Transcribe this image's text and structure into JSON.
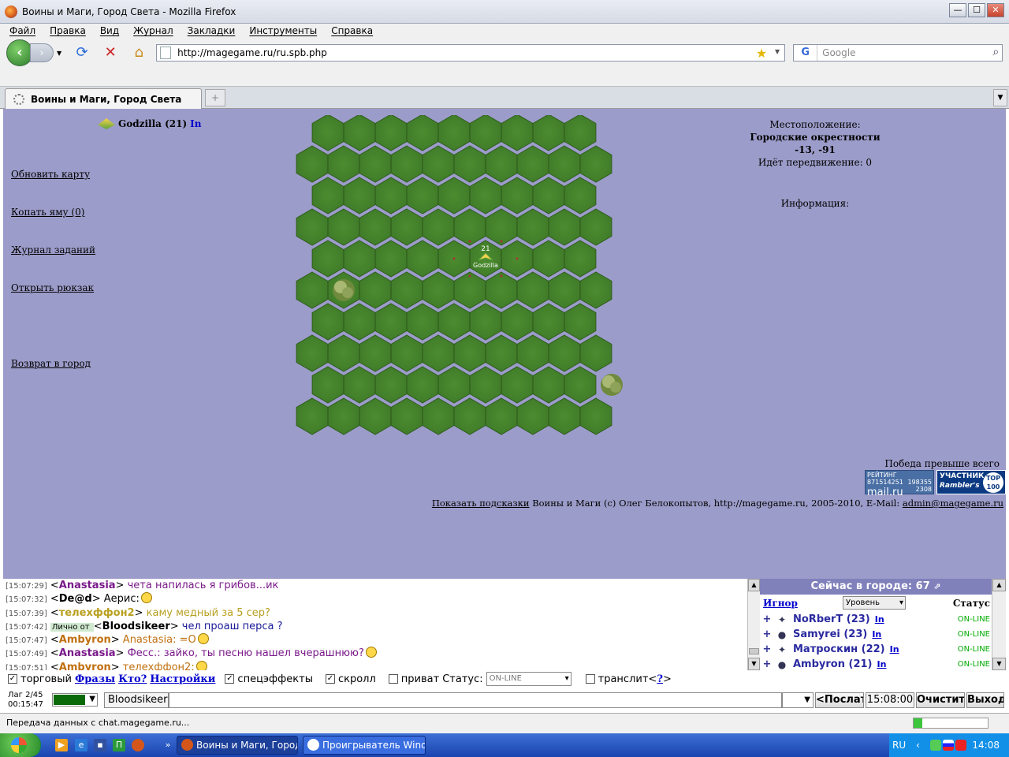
{
  "window": {
    "title": "Воины и Маги, Город Света - Mozilla Firefox",
    "min": "—",
    "max": "☐",
    "close": "✕"
  },
  "menu": [
    "Файл",
    "Правка",
    "Вид",
    "Журнал",
    "Закладки",
    "Инструменты",
    "Справка"
  ],
  "nav": {
    "url": "http://magegame.ru/ru.spb.php",
    "search_placeholder": "Google"
  },
  "tab": {
    "title": "Воины и Маги, Город Света"
  },
  "game": {
    "player": {
      "name": "Godzilla (21)",
      "in": "In"
    },
    "links": [
      "Обновить карту",
      "Копать яму (0)",
      "Журнал заданий",
      "Открыть рюкзак",
      "Возврат в город"
    ],
    "location": {
      "label": "Местоположение:",
      "place": "Городские окрестности",
      "coords": "-13, -91",
      "movement": "Идёт передвижение: 0"
    },
    "info_label": "Информация:",
    "map": {
      "cols": 10,
      "rows": 10,
      "player_marker": {
        "level": "21",
        "name": "Godzilla",
        "col": 5,
        "row": 4
      },
      "bushes": [
        {
          "col": 1,
          "row": 5
        },
        {
          "col": 9,
          "row": 8
        }
      ],
      "grass_color": "#3f7a28",
      "edge_color": "#2e5c1c"
    },
    "victory": "Победа превыше всего",
    "counters": {
      "mailru": {
        "line1": "РЕЙТИНГ 871514251",
        "brand": "mail.ru",
        "n1": "198355",
        "n2": "2308"
      },
      "rambler": {
        "line1": "УЧАСТНИК",
        "line2": "Rambler's",
        "top_a": "TOP",
        "top_b": "100"
      }
    },
    "footer": {
      "hints": "Показать подсказки",
      "copyright": "Воины и Маги (c) Олег Белокопытов, http://magegame.ru, 2005-2010, E-Mail:",
      "email": "admin@magegame.ru"
    }
  },
  "chat": {
    "messages": [
      {
        "time": "[15:07:29]",
        "nick": "Anastasia",
        "nick_color": "#7a1a8a",
        "text": "чета напилась я грибов...ик",
        "text_color": "#7a1a8a",
        "smile": false,
        "private": ""
      },
      {
        "time": "[15:07:32]",
        "nick": "De@d",
        "nick_color": "#000000",
        "text": "Аерис:",
        "text_color": "#000000",
        "smile": true,
        "private": ""
      },
      {
        "time": "[15:07:39]",
        "nick": "телехффон2",
        "nick_color": "#b8a020",
        "text": "каму медный за 5 сер?",
        "text_color": "#b8a020",
        "smile": false,
        "private": ""
      },
      {
        "time": "[15:07:42]",
        "nick": "Bloodsikeer",
        "nick_color": "#000000",
        "text": "чел проаш перса ?",
        "text_color": "#1a1a9a",
        "smile": false,
        "private": "Лично от "
      },
      {
        "time": "[15:07:47]",
        "nick": "Ambyron",
        "nick_color": "#c07010",
        "text": "Anastasia: =O",
        "text_color": "#c07010",
        "smile": true,
        "private": ""
      },
      {
        "time": "[15:07:49]",
        "nick": "Anastasia",
        "nick_color": "#7a1a8a",
        "text": "Фесс.: зайко, ты песню нашел вчерашнюю?",
        "text_color": "#7a1a8a",
        "smile": true,
        "private": ""
      },
      {
        "time": "[15:07:51]",
        "nick": "Ambyron",
        "nick_color": "#c07010",
        "text": "телехффон2:",
        "text_color": "#c07010",
        "smile": true,
        "private": ""
      }
    ]
  },
  "online": {
    "title": "Сейчас в городе: 67",
    "ignore": "Игнор",
    "sort": "Уровень",
    "status_header": "Статус",
    "users": [
      {
        "name": "NoRberT (23)",
        "in": "In",
        "status": "ON-LINE",
        "cls": "✦"
      },
      {
        "name": "Samyrei (23)",
        "in": "In",
        "status": "ON-LINE",
        "cls": "●"
      },
      {
        "name": "Матроскин (22)",
        "in": "In",
        "status": "ON-LINE",
        "cls": "✦"
      },
      {
        "name": "Ambyron (21)",
        "in": "In",
        "status": "ON-LINE",
        "cls": "●"
      }
    ]
  },
  "controls": {
    "trade": "торговый",
    "phrases": "Фразы",
    "who": "Кто?",
    "settings": "Настройки",
    "effects": "спецэффекты",
    "scroll": "скролл",
    "private": "приват",
    "status_label": "Статус:",
    "status_value": "ON-LINE",
    "translit": "транслит",
    "help_open": "<",
    "help_q": "?",
    "help_close": ">"
  },
  "input": {
    "lag1": "Лаг 2/45",
    "lag2": "00:15:47",
    "nick": "Bloodsikeer",
    "send": "<Послать",
    "time": "15:08:00",
    "clear": "Очистить",
    "exit": "Выход"
  },
  "statusbar": {
    "text": "Передача данных с chat.magegame.ru...",
    "progress": 0.12
  },
  "taskbar": {
    "tasks": [
      "Воины и Маги, Город...",
      "Проигрыватель Wind..."
    ],
    "lang": "RU",
    "clock": "14:08"
  }
}
